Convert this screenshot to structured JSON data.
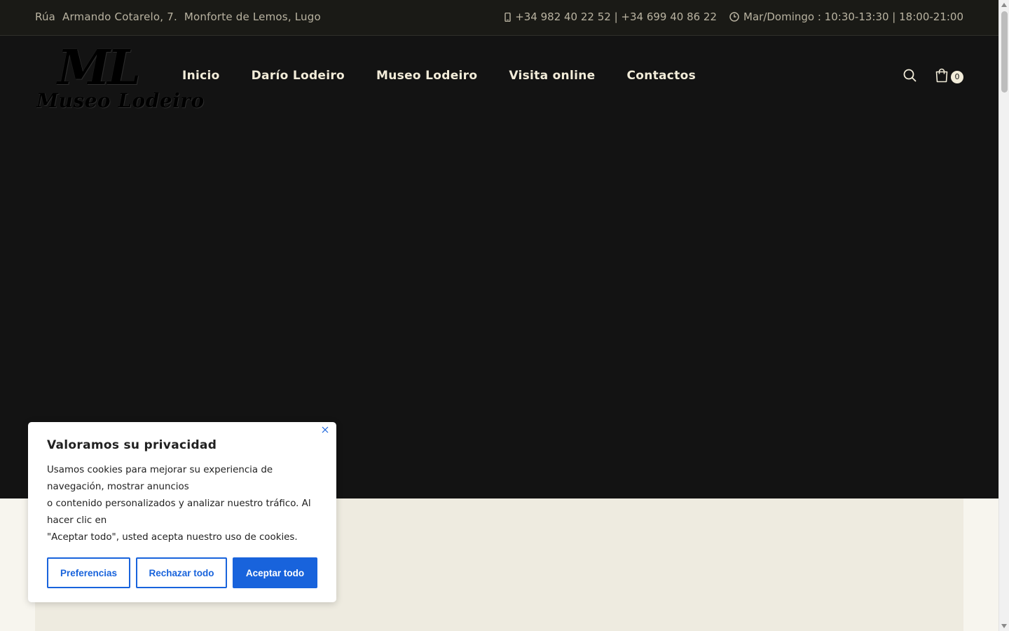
{
  "topbar": {
    "address": "Rúa  Armando Cotarelo, 7.  Monforte de Lemos, Lugo",
    "phone_icon": "mobile-phone-icon",
    "phones": "+34 982 40 22 52 | +34 699 40 86 22",
    "clock_icon": "clock-icon",
    "hours": "Mar/Domingo : 10:30-13:30 | 18:00-21:00"
  },
  "logo": {
    "monogram": "ML",
    "name": "Museo Lodeiro"
  },
  "nav": {
    "items": [
      {
        "label": "Inicio"
      },
      {
        "label": "Darío Lodeiro"
      },
      {
        "label": "Museo Lodeiro"
      },
      {
        "label": "Visita online"
      },
      {
        "label": "Contactos"
      }
    ]
  },
  "header_icons": {
    "search_icon": "search-icon",
    "cart_icon": "shopping-bag-icon",
    "cart_count": "0"
  },
  "cookie_banner": {
    "title": "Valoramos su privacidad",
    "lines": [
      "Usamos cookies para mejorar su experiencia de navegación, mostrar anuncios",
      "o contenido personalizados y analizar nuestro tráfico. Al hacer clic en",
      "\"Aceptar todo\", usted acepta nuestro uso de cookies."
    ],
    "close_icon": "close-icon",
    "buttons": {
      "preferences": "Preferencias",
      "reject": "Rechazar todo",
      "accept": "Aceptar todo"
    }
  },
  "colors": {
    "topbar_bg": "#1a1a16",
    "header_bg": "#131313",
    "nav_text": "#f2ecd9",
    "page_bg": "#f7f5ee",
    "panel_bg": "#eeebe0",
    "cookie_accent": "#1863dc"
  }
}
